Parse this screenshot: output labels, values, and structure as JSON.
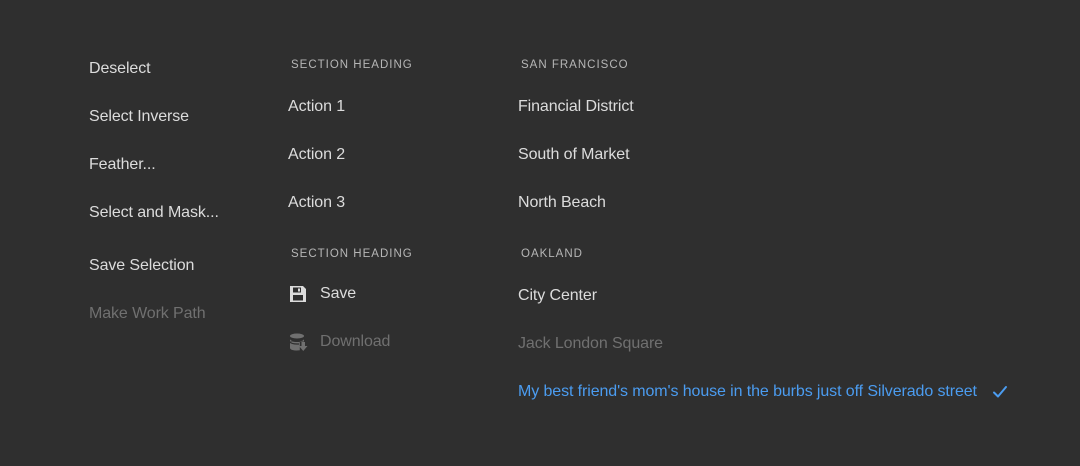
{
  "colors": {
    "background": "#2f2f2f",
    "text": "#dcdcdc",
    "heading": "#b6b6b6",
    "disabled": "#707070",
    "selected": "#4b9cf0"
  },
  "menu1": {
    "items": [
      {
        "label": "Deselect",
        "disabled": false
      },
      {
        "label": "Select Inverse",
        "disabled": false
      },
      {
        "label": "Feather...",
        "disabled": false
      },
      {
        "label": "Select and Mask...",
        "disabled": false
      },
      {
        "label": "Save Selection",
        "disabled": false
      },
      {
        "label": "Make Work Path",
        "disabled": true
      }
    ]
  },
  "menu2": {
    "sections": [
      {
        "heading": "SECTION HEADING",
        "items": [
          {
            "label": "Action 1"
          },
          {
            "label": "Action 2"
          },
          {
            "label": "Action 3"
          }
        ]
      },
      {
        "heading": "SECTION HEADING",
        "items": [
          {
            "label": "Save",
            "icon": "save-icon",
            "disabled": false
          },
          {
            "label": "Download",
            "icon": "download-icon",
            "disabled": true
          }
        ]
      }
    ]
  },
  "menu3": {
    "sections": [
      {
        "heading": "SAN FRANCISCO",
        "items": [
          {
            "label": "Financial District"
          },
          {
            "label": "South of Market"
          },
          {
            "label": "North Beach"
          }
        ]
      },
      {
        "heading": "OAKLAND",
        "items": [
          {
            "label": "City Center",
            "disabled": false
          },
          {
            "label": "Jack London Square",
            "disabled": true
          },
          {
            "label": "My best friend's mom's house in the burbs just off Silverado street",
            "selected": true,
            "icon": "checkmark-icon"
          }
        ]
      }
    ]
  }
}
